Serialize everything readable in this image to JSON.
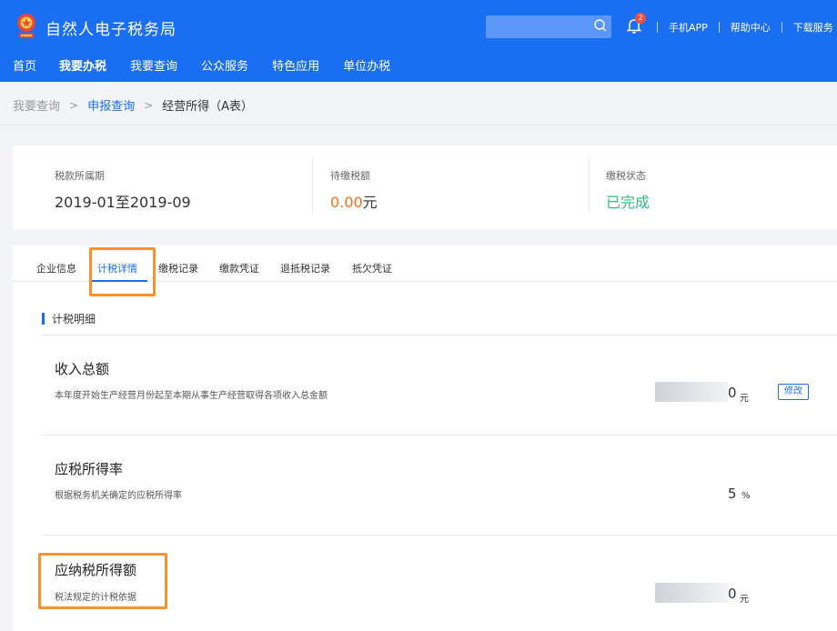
{
  "header": {
    "app_title": "自然人电子税务局",
    "notification_count": "2",
    "links": [
      "手机APP",
      "帮助中心",
      "下载服务"
    ]
  },
  "nav": {
    "items": [
      {
        "label": "首页"
      },
      {
        "label": "我要办税",
        "active": true
      },
      {
        "label": "我要查询"
      },
      {
        "label": "公众服务"
      },
      {
        "label": "特色应用"
      },
      {
        "label": "单位办税"
      }
    ]
  },
  "breadcrumb": {
    "level1": "我要查询",
    "level2": "申报查询",
    "current": "经营所得（A表）"
  },
  "summary": {
    "period_label": "税款所属期",
    "period_value": "2019-01至2019-09",
    "due_label": "待缴税额",
    "due_value": "0.00",
    "due_unit": "元",
    "status_label": "缴税状态",
    "status_value": "已完成"
  },
  "tabs": {
    "items": [
      "企业信息",
      "计税详情",
      "缴税记录",
      "缴款凭证",
      "退抵税记录",
      "抵欠凭证"
    ],
    "active_index": 1
  },
  "detail": {
    "section_title": "计税明细",
    "rows": [
      {
        "title": "收入总额",
        "desc": "本年度开始生产经营月份起至本期从事生产经营取得各项收入总金额",
        "value": "0",
        "unit": "元",
        "action": "修改"
      },
      {
        "title": "应税所得率",
        "desc": "根据税务机关确定的应税所得率",
        "value": "5",
        "unit": "%"
      },
      {
        "title": "应纳税所得额",
        "desc": "税法规定的计税依据",
        "value": "0",
        "unit": "元"
      }
    ]
  },
  "colors": {
    "brand_blue": "#1a6ef2",
    "highlight_orange": "#f7922f",
    "amount_orange": "#f2711c",
    "status_green": "#2ec07c"
  }
}
